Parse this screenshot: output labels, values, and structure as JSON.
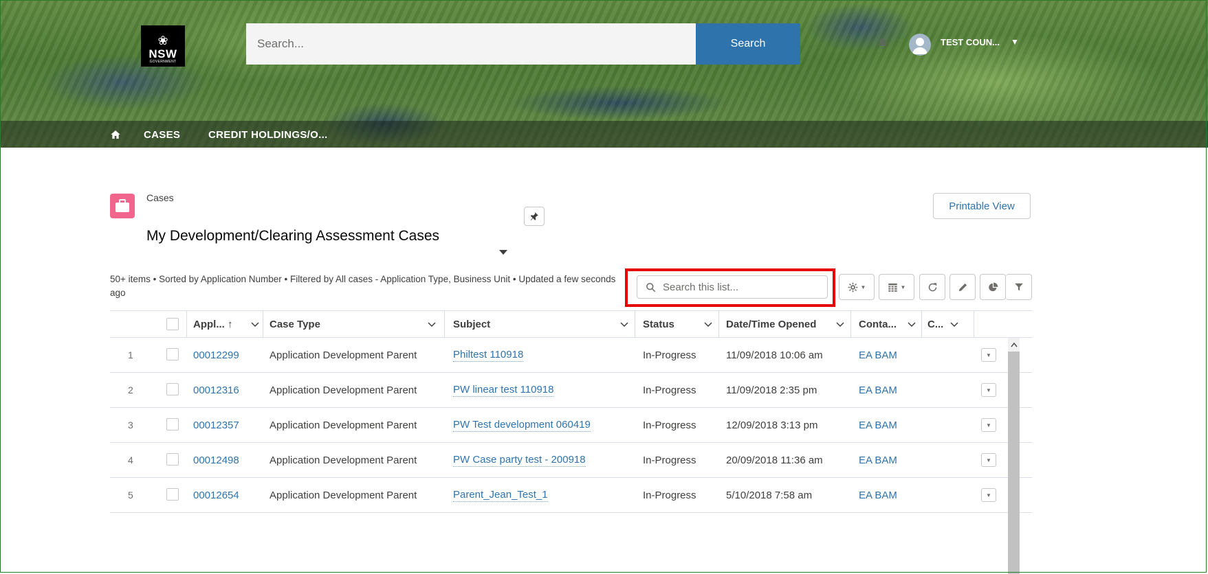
{
  "header": {
    "logo_text": "NSW",
    "logo_subtext": "GOVERNMENT",
    "search_placeholder": "Search...",
    "search_button": "Search",
    "user_name": "TEST COUN..."
  },
  "nav": {
    "items": [
      {
        "label": "CASES"
      },
      {
        "label": "CREDIT HOLDINGS/O..."
      }
    ]
  },
  "list_header": {
    "object_label": "Cases",
    "title": "My Development/Clearing Assessment Cases",
    "printable_view": "Printable View",
    "meta_text": "50+ items • Sorted by Application Number • Filtered by All cases - Application Type, Business Unit • Updated a few seconds ago",
    "search_placeholder": "Search this list..."
  },
  "table": {
    "columns": [
      {
        "label": "Appl... ↑"
      },
      {
        "label": "Case Type"
      },
      {
        "label": "Subject"
      },
      {
        "label": "Status"
      },
      {
        "label": "Date/Time Opened"
      },
      {
        "label": "Conta..."
      },
      {
        "label": "C..."
      }
    ],
    "rows": [
      {
        "n": "1",
        "app": "00012299",
        "type": "Application Development Parent",
        "subject": "Philtest 110918",
        "status": "In-Progress",
        "opened": "11/09/2018 10:06 am",
        "contact": "EA BAM"
      },
      {
        "n": "2",
        "app": "00012316",
        "type": "Application Development Parent",
        "subject": "PW linear test 110918",
        "status": "In-Progress",
        "opened": "11/09/2018 2:35 pm",
        "contact": "EA BAM"
      },
      {
        "n": "3",
        "app": "00012357",
        "type": "Application Development Parent",
        "subject": "PW Test development 060419",
        "status": "In-Progress",
        "opened": "12/09/2018 3:13 pm",
        "contact": "EA BAM"
      },
      {
        "n": "4",
        "app": "00012498",
        "type": "Application Development Parent",
        "subject": "PW Case party test - 200918",
        "status": "In-Progress",
        "opened": "20/09/2018 11:36 am",
        "contact": "EA BAM"
      },
      {
        "n": "5",
        "app": "00012654",
        "type": "Application Development Parent",
        "subject": "Parent_Jean_Test_1",
        "status": "In-Progress",
        "opened": "5/10/2018 7:58 am",
        "contact": "EA BAM"
      }
    ]
  },
  "colors": {
    "brand_blue": "#2f73ad",
    "case_icon": "#f2658d",
    "highlight_red": "#e60000"
  }
}
